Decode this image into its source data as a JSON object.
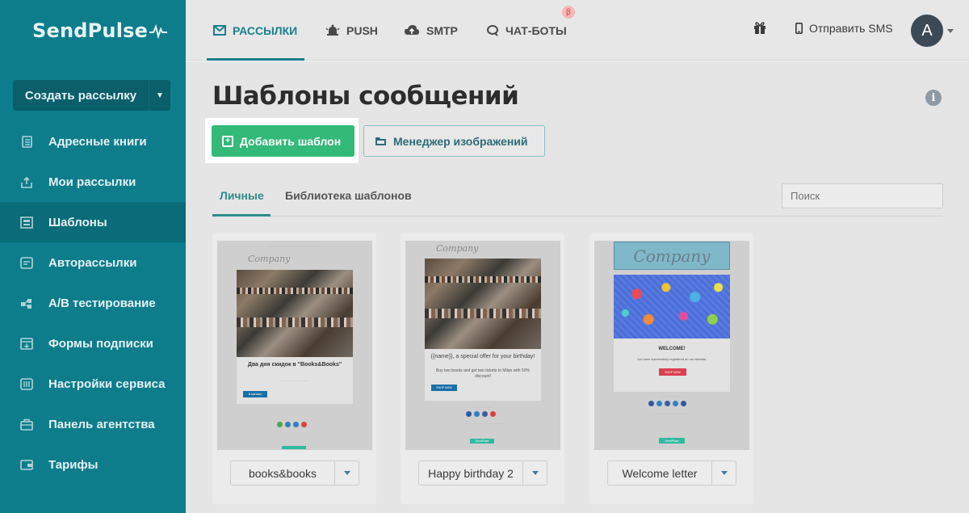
{
  "app": {
    "logo": "SendPulse"
  },
  "sidebar": {
    "create_button": "Создать рассылку",
    "items": [
      {
        "label": "Адресные книги",
        "icon": "address-book-icon"
      },
      {
        "label": "Мои рассылки",
        "icon": "campaigns-icon"
      },
      {
        "label": "Шаблоны",
        "icon": "templates-icon"
      },
      {
        "label": "Авторассылки",
        "icon": "automation-icon"
      },
      {
        "label": "A/B тестирование",
        "icon": "ab-test-icon"
      },
      {
        "label": "Формы подписки",
        "icon": "forms-icon"
      },
      {
        "label": "Настройки сервиса",
        "icon": "settings-icon"
      },
      {
        "label": "Панель агентства",
        "icon": "agency-icon"
      },
      {
        "label": "Тарифы",
        "icon": "wallet-icon"
      }
    ]
  },
  "topnav": {
    "items": [
      {
        "label": "РАССЫЛКИ",
        "icon": "envelope-icon"
      },
      {
        "label": "PUSH",
        "icon": "bell-icon"
      },
      {
        "label": "SMTP",
        "icon": "cloud-upload-icon"
      },
      {
        "label": "ЧАТ-БОТЫ",
        "icon": "chat-icon"
      }
    ],
    "beta_badge": "β",
    "sms_label": "Отправить SMS",
    "avatar_letter": "A"
  },
  "main": {
    "title": "Шаблоны сообщений",
    "add_template": "Добавить шаблон",
    "image_manager": "Менеджер изображений",
    "tabs": [
      "Личные",
      "Библиотека шаблонов"
    ],
    "search_placeholder": "Поиск"
  },
  "templates": [
    {
      "name": "books&books",
      "preview": {
        "logo": "Company",
        "headline": "Два дня скидок в \"Books&Books\"",
        "button": "В магазин"
      }
    },
    {
      "name": "Happy birthday 2",
      "preview": {
        "logo": "Company",
        "headline": "{{name}}, a special offer for your birthday!",
        "subtext": "Buy two books and get two tickets to Milan with 50% discount!",
        "button": "SHOP NOW",
        "footer_badge": "SendPulse"
      }
    },
    {
      "name": "Welcome letter",
      "preview": {
        "logo": "Company",
        "headline": "WELCOME!",
        "subtext": "You have successfully registered on our website.",
        "button": "SHOP NOW",
        "footer_badge": "SendPulse"
      }
    }
  ],
  "colors": {
    "sidebar": "#0d7d8c",
    "accent": "#1a7f8e",
    "add_button": "#33b978"
  }
}
